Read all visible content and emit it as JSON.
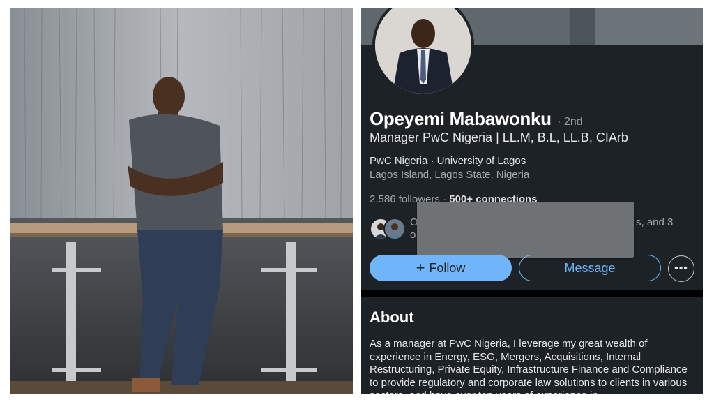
{
  "profile": {
    "name": "Opeyemi Mabawonku",
    "degree": "· 2nd",
    "headline": "Manager PwC Nigeria | LL.M, B.L, LL.B, CIArb",
    "education": "PwC Nigeria · University of Lagos",
    "location": "Lagos Island, Lagos State, Nigeria",
    "followers": "2,586 followers",
    "separator": " · ",
    "connections": "500+ connections",
    "mutual_line1_start": "O",
    "mutual_line1_end": "s, and 3",
    "mutual_line2_start": "o"
  },
  "actions": {
    "follow_label": "Follow",
    "follow_icon": "+",
    "message_label": "Message",
    "more_icon": "•••"
  },
  "about": {
    "title": "About",
    "text": "As a manager at PwC Nigeria, I leverage my great wealth of experience in Energy, ESG, Mergers, Acquisitions, Internal Restructuring, Private Equity, Infrastructure Finance and Compliance to provide regulatory and corporate law solutions to clients in various sectors, and have over ten years of experience in"
  },
  "colors": {
    "background": "#1d2226",
    "accent": "#70b5f9",
    "muted_text": "#a3a9ad"
  }
}
